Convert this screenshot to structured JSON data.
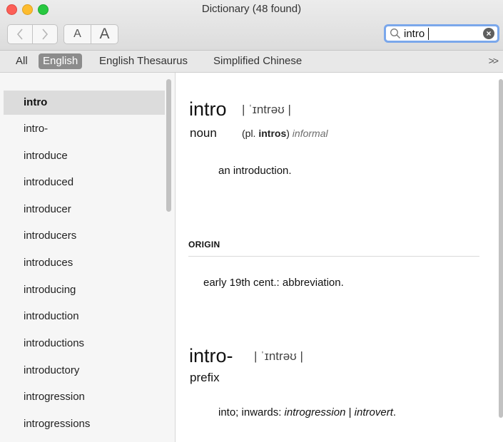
{
  "window": {
    "title": "Dictionary (48 found)"
  },
  "toolbar": {
    "back_icon": "chevron-left-icon",
    "forward_icon": "chevron-right-icon",
    "font_smaller_label": "A",
    "font_larger_label": "A",
    "search_value": "intro",
    "search_icon": "magnifier-icon",
    "clear_icon": "clear-circle-icon"
  },
  "sources": {
    "tabs": [
      "All",
      "English",
      "English Thesaurus",
      "Simplified Chinese"
    ],
    "active": "English",
    "overflow": ">>"
  },
  "word_list": {
    "selected": "intro",
    "items": [
      "intro",
      "intro-",
      "introduce",
      "introduced",
      "introducer",
      "introducers",
      "introduces",
      "introducing",
      "introduction",
      "introductions",
      "introductory",
      "introgression",
      "introgressions"
    ]
  },
  "entries": [
    {
      "headword": "intro",
      "pronunciation": "| ˈɪntrəʊ |",
      "part_of_speech": "noun",
      "grammar_open": "(pl. ",
      "plural": "intros",
      "grammar_close": ")",
      "register": "informal",
      "definition": "an introduction.",
      "origin_heading": "ORIGIN",
      "origin_text": "early 19th cent.: abbreviation."
    },
    {
      "headword": "intro-",
      "pronunciation": "| ˈɪntrəʊ |",
      "part_of_speech": "prefix",
      "definition_prefix": "into; inwards: ",
      "example_1": "introgression",
      "separator": " | ",
      "example_2": "introvert",
      "definition_end": "."
    }
  ],
  "colors": {
    "accent": "#7aa7eb",
    "selected_tab": "#8c8c8c",
    "selected_row": "#dcdcdc"
  }
}
